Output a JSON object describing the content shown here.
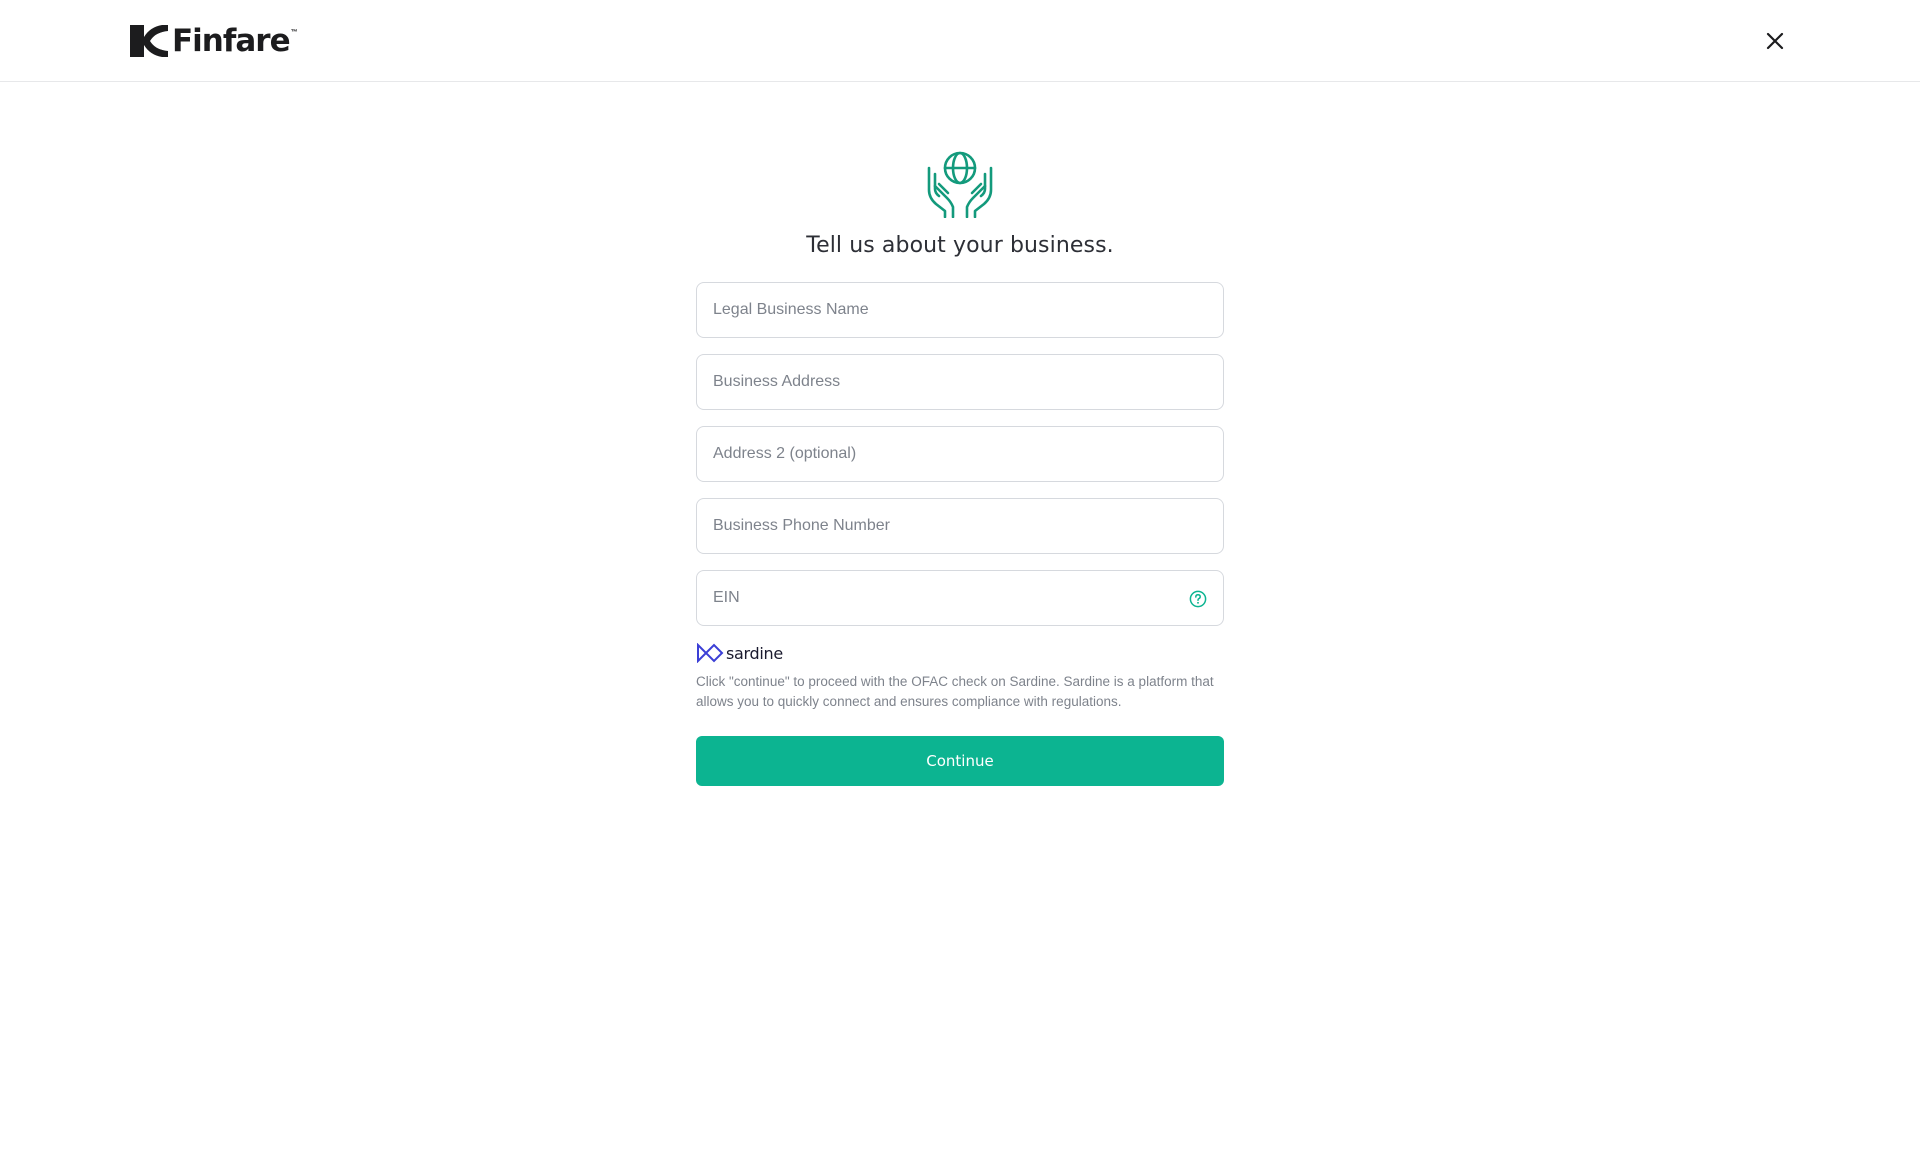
{
  "header": {
    "logo_text": "Finfare",
    "logo_tm": "™",
    "close_icon": "close-icon"
  },
  "form": {
    "hero_icon": "hands-globe-icon",
    "title": "Tell us about your business.",
    "fields": [
      {
        "placeholder": "Legal Business Name",
        "value": ""
      },
      {
        "placeholder": "Business Address",
        "value": ""
      },
      {
        "placeholder": "Address 2 (optional)",
        "value": ""
      },
      {
        "placeholder": "Business Phone Number",
        "value": ""
      },
      {
        "placeholder": "EIN",
        "value": "",
        "help_icon": "question-circle-icon"
      }
    ],
    "partner": {
      "name": "sardine",
      "icon": "sardine-logo-icon"
    },
    "disclaimer": "Click \"continue\" to proceed with the OFAC check on Sardine. Sardine is a platform that allows you to quickly connect and ensures compliance with regulations.",
    "continue_label": "Continue"
  },
  "colors": {
    "accent": "#0cb491",
    "icon_green": "#139a7c",
    "sardine_blue": "#3b3fd6",
    "border": "#d6d9de",
    "placeholder": "#7e838c"
  }
}
